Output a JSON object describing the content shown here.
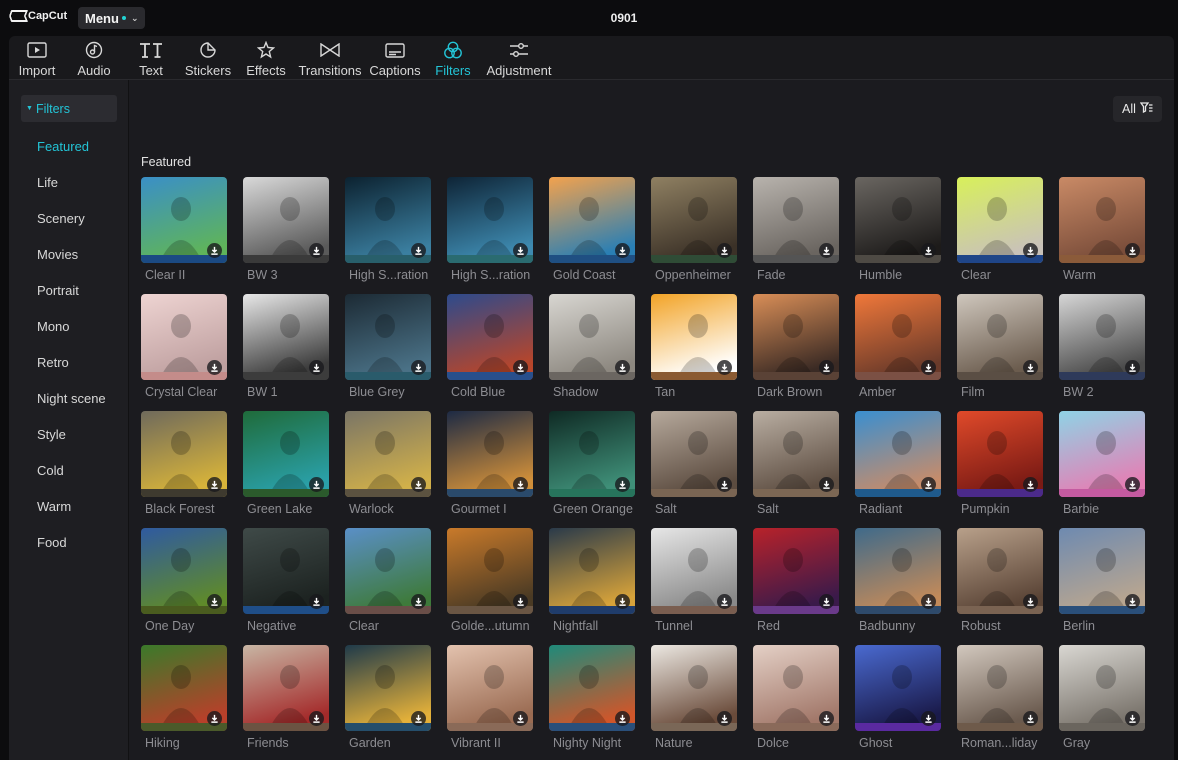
{
  "app": {
    "logo_text": "CapCut",
    "menu_label": "Menu",
    "project_name": "0901"
  },
  "toolbar": {
    "tabs": [
      {
        "label": "Import",
        "icon": "import-icon"
      },
      {
        "label": "Audio",
        "icon": "audio-icon"
      },
      {
        "label": "Text",
        "icon": "text-icon"
      },
      {
        "label": "Stickers",
        "icon": "stickers-icon"
      },
      {
        "label": "Effects",
        "icon": "effects-icon"
      },
      {
        "label": "Transitions",
        "icon": "transitions-icon"
      },
      {
        "label": "Captions",
        "icon": "captions-icon"
      },
      {
        "label": "Filters",
        "icon": "filters-icon",
        "active": true
      },
      {
        "label": "Adjustment",
        "icon": "adjustment-icon"
      }
    ]
  },
  "sidebar": {
    "header": "Filters",
    "items": [
      {
        "label": "Featured",
        "active": true
      },
      {
        "label": "Life"
      },
      {
        "label": "Scenery"
      },
      {
        "label": "Movies"
      },
      {
        "label": "Portrait"
      },
      {
        "label": "Mono"
      },
      {
        "label": "Retro"
      },
      {
        "label": "Night scene"
      },
      {
        "label": "Style"
      },
      {
        "label": "Cold"
      },
      {
        "label": "Warm"
      },
      {
        "label": "Food"
      }
    ]
  },
  "content": {
    "filter_button": "All",
    "section_title": "Featured",
    "filters": [
      {
        "name": "Clear II",
        "colors": [
          "#3a8fc7",
          "#5fb45a"
        ],
        "bar": "#1b4a83"
      },
      {
        "name": "BW 3",
        "colors": [
          "#d9d9d9",
          "#5a5a5a"
        ],
        "bar": "#3a3a3a"
      },
      {
        "name": "High S...ration",
        "colors": [
          "#0c2230",
          "#3b7fa0"
        ],
        "bar": "#285f6b"
      },
      {
        "name": "High S...ration",
        "colors": [
          "#0e2436",
          "#3e8ab0"
        ],
        "bar": "#2a6b70"
      },
      {
        "name": "Gold Coast",
        "colors": [
          "#f3a24d",
          "#2a7fb4"
        ],
        "bar": "#1f4f82"
      },
      {
        "name": "Oppenheimer",
        "colors": [
          "#8f8062",
          "#3b3127"
        ],
        "bar": "#2f4c36"
      },
      {
        "name": "Fade",
        "colors": [
          "#b8b3ad",
          "#6a6560"
        ],
        "bar": "#545454"
      },
      {
        "name": "Humble",
        "colors": [
          "#6a6661",
          "#1d1b1a"
        ],
        "bar": "#4e4a44"
      },
      {
        "name": "Clear",
        "colors": [
          "#d8f05a",
          "#c9c2b9"
        ],
        "bar": "#1f4588"
      },
      {
        "name": "Warm",
        "colors": [
          "#c98a66",
          "#7a4d3a"
        ],
        "bar": "#8b5b3a"
      },
      {
        "name": "Crystal Clear",
        "colors": [
          "#eed4d2",
          "#bfa0a0"
        ],
        "bar": "#c48c8a"
      },
      {
        "name": "BW 1",
        "colors": [
          "#e8e8e8",
          "#3c3c3c"
        ],
        "bar": "#3c3c3c"
      },
      {
        "name": "Blue Grey",
        "colors": [
          "#1c2a34",
          "#4a7186"
        ],
        "bar": "#2a5b6b"
      },
      {
        "name": "Cold Blue",
        "colors": [
          "#2d4a8c",
          "#b7462b"
        ],
        "bar": "#284f8c"
      },
      {
        "name": "Shadow",
        "colors": [
          "#d8d6d1",
          "#8d8880"
        ],
        "bar": "#6b6661"
      },
      {
        "name": "Tan",
        "colors": [
          "#f2a326",
          "#ffffff"
        ],
        "bar": "#8a5a32"
      },
      {
        "name": "Dark Brown",
        "colors": [
          "#d98e57",
          "#3a2a24"
        ],
        "bar": "#5a4236"
      },
      {
        "name": "Amber",
        "colors": [
          "#f0783a",
          "#6a3a2a"
        ],
        "bar": "#7b5044"
      },
      {
        "name": "Film",
        "colors": [
          "#cfc7bd",
          "#6b5c4e"
        ],
        "bar": "#5a4e44"
      },
      {
        "name": "BW 2",
        "colors": [
          "#d6d6d6",
          "#4a4a4a"
        ],
        "bar": "#2e3a5a"
      },
      {
        "name": "Black Forest",
        "colors": [
          "#6f6a5c",
          "#d7b33a"
        ],
        "bar": "#3e3a2f"
      },
      {
        "name": "Green Lake",
        "colors": [
          "#1f6b3a",
          "#2aa0a8"
        ],
        "bar": "#2b5a2c"
      },
      {
        "name": "Warlock",
        "colors": [
          "#7a7566",
          "#d1b04a"
        ],
        "bar": "#5b5240"
      },
      {
        "name": "Gourmet I",
        "colors": [
          "#1d2a44",
          "#d08f3a"
        ],
        "bar": "#2a4a6b"
      },
      {
        "name": "Green Orange",
        "colors": [
          "#0f2a24",
          "#3f8f78"
        ],
        "bar": "#27745c"
      },
      {
        "name": "Salt",
        "colors": [
          "#b6a99c",
          "#5c4c40"
        ],
        "bar": "#7a6553"
      },
      {
        "name": "Salt",
        "colors": [
          "#b9aea2",
          "#5e4e42"
        ],
        "bar": "#7c6754"
      },
      {
        "name": "Radiant",
        "colors": [
          "#3a8fd0",
          "#c78c6a"
        ],
        "bar": "#1f5a8c"
      },
      {
        "name": "Pumpkin",
        "colors": [
          "#e04a2a",
          "#7a1a14"
        ],
        "bar": "#4b2a8a"
      },
      {
        "name": "Barbie",
        "colors": [
          "#8fd3e6",
          "#e47fb4"
        ],
        "bar": "#c45aa0"
      },
      {
        "name": "One Day",
        "colors": [
          "#2f5aa0",
          "#5f8a2a"
        ],
        "bar": "#4a5c1f"
      },
      {
        "name": "Negative",
        "colors": [
          "#3f4a48",
          "#1c2220"
        ],
        "bar": "#1f4e88"
      },
      {
        "name": "Clear",
        "colors": [
          "#5a8fc7",
          "#3e7a3a"
        ],
        "bar": "#6a4e48"
      },
      {
        "name": "Golde...utumn",
        "colors": [
          "#c97a2a",
          "#4a3a24"
        ],
        "bar": "#6a5644"
      },
      {
        "name": "Nightfall",
        "colors": [
          "#2a3a4a",
          "#d6a23a"
        ],
        "bar": "#1f3c6b"
      },
      {
        "name": "Tunnel",
        "colors": [
          "#e6e6e6",
          "#8a8a8a"
        ],
        "bar": "#7a5e50"
      },
      {
        "name": "Red",
        "colors": [
          "#b8222a",
          "#3a1a4a"
        ],
        "bar": "#6a3a8a"
      },
      {
        "name": "Badbunny",
        "colors": [
          "#3f6a8a",
          "#c28a5a"
        ],
        "bar": "#2e4a6b"
      },
      {
        "name": "Robust",
        "colors": [
          "#b8a08a",
          "#5a4436"
        ],
        "bar": "#7a6352"
      },
      {
        "name": "Berlin",
        "colors": [
          "#6e8ab0",
          "#b9a690"
        ],
        "bar": "#2a4f7a"
      },
      {
        "name": "Hiking",
        "colors": [
          "#3a7a2a",
          "#b8402a"
        ],
        "bar": "#4b5a2a"
      },
      {
        "name": "Friends",
        "colors": [
          "#c8b6a4",
          "#a42a2a"
        ],
        "bar": "#6b5342"
      },
      {
        "name": "Garden",
        "colors": [
          "#1f3a4a",
          "#e3b03a"
        ],
        "bar": "#254e6b"
      },
      {
        "name": "Vibrant II",
        "colors": [
          "#e3c2ae",
          "#9a6b52"
        ],
        "bar": "#8a6a58"
      },
      {
        "name": "Nighty Night",
        "colors": [
          "#1f8a7a",
          "#d0562a"
        ],
        "bar": "#2a4f7a"
      },
      {
        "name": "Nature",
        "colors": [
          "#ece8e2",
          "#6a4b3a"
        ],
        "bar": "#7a6757"
      },
      {
        "name": "Dolce",
        "colors": [
          "#e4d0c6",
          "#a2786a"
        ],
        "bar": "#8a6a5a"
      },
      {
        "name": "Ghost",
        "colors": [
          "#4a6ad0",
          "#1a1a4a"
        ],
        "bar": "#5a2aa0"
      },
      {
        "name": "Roman...liday",
        "colors": [
          "#d2c8be",
          "#6a5a4e"
        ],
        "bar": "#6e5a4a"
      },
      {
        "name": "Gray",
        "colors": [
          "#d9d7d2",
          "#7a746c"
        ],
        "bar": "#6a655e"
      }
    ]
  }
}
